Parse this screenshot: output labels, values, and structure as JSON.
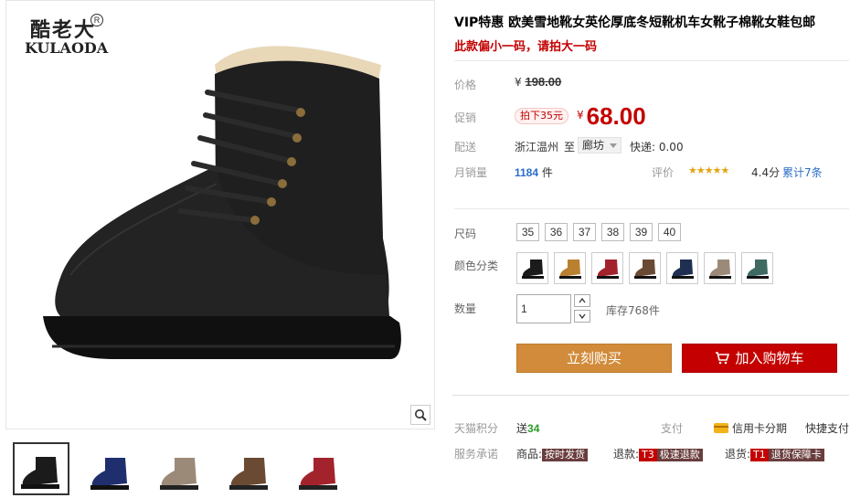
{
  "brand": {
    "cn": "酷老大",
    "en": "KULAODA",
    "reg": "R"
  },
  "product": {
    "title": "VIP特惠 欧美雪地靴女英伦厚底冬短靴机车女靴子棉靴女鞋包邮",
    "subtitle": "此款偏小一码，请拍大一码"
  },
  "price": {
    "label": "价格",
    "currency": "¥",
    "original": "198.00",
    "promo_label": "促销",
    "promo_tag": "拍下35元",
    "promo_value": "68.00"
  },
  "shipping": {
    "label": "配送",
    "from": "浙江温州",
    "to_word": "至",
    "dest": "廊坊",
    "fee": "快递: 0.00"
  },
  "sales": {
    "label": "月销量",
    "count": "1184",
    "unit": "件",
    "rating_label": "评价",
    "stars": "★★★★★",
    "score": "4.4分",
    "reviews": "累计7条",
    "rating": 4.4
  },
  "size": {
    "label": "尺码",
    "options": [
      "35",
      "36",
      "37",
      "38",
      "39",
      "40"
    ]
  },
  "color": {
    "label": "颜色分类",
    "swatches": [
      "#1b1b1b",
      "#b9802f",
      "#a3232c",
      "#6b4a34",
      "#1f2f52",
      "#9c8a78",
      "#3e6a63"
    ]
  },
  "quantity": {
    "label": "数量",
    "value": "1",
    "stock": "库存768件"
  },
  "actions": {
    "buy": "立刻购买",
    "cart": "加入购物车"
  },
  "footer": {
    "points_label": "天猫积分",
    "points_prefix": "送",
    "points_value": "34",
    "pay_label": "支付",
    "credit": "信用卡分期",
    "quick_pay": "快捷支付",
    "promise_label": "服务承诺",
    "goods_label": "商品:",
    "goods_tag": "按时发货",
    "refund_label": "退款:",
    "refund_t": "T3",
    "refund_tag": "极速退款",
    "return_label": "退货:",
    "return_t": "T1",
    "return_tag": "退货保障卡"
  },
  "gallery": {
    "thumb_colors": [
      "#1b1b1b",
      "#1f2f6e",
      "#9c8a78",
      "#6b4a34",
      "#a3232c"
    ]
  }
}
